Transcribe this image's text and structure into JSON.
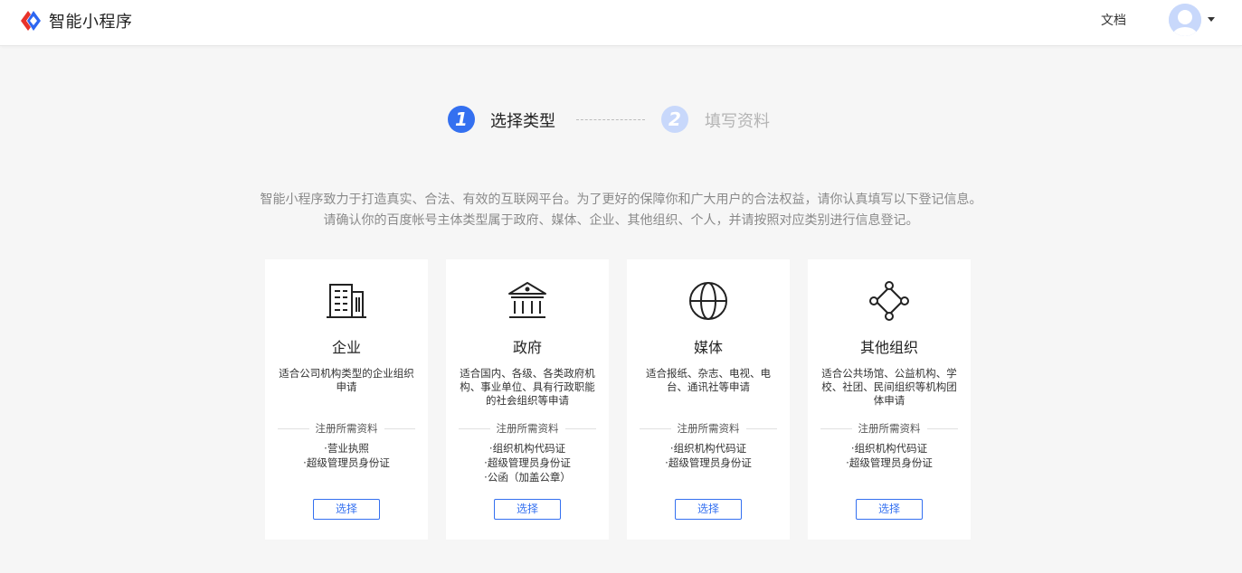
{
  "header": {
    "app_name": "智能小程序",
    "docs_label": "文档"
  },
  "steps": [
    {
      "number": "1",
      "label": "选择类型",
      "state": "active"
    },
    {
      "number": "2",
      "label": "填写资料",
      "state": "inactive"
    }
  ],
  "intro": {
    "line1": "智能小程序致力于打造真实、合法、有效的互联网平台。为了更好的保障你和广大用户的合法权益，请你认真填写以下登记信息。",
    "line2": "请确认你的百度帐号主体类型属于政府、媒体、企业、其他组织、个人，并请按照对应类别进行信息登记。"
  },
  "cards": [
    {
      "icon": "building-icon",
      "title": "企业",
      "desc": "适合公司机构类型的企业组织申请",
      "req_title": "注册所需资料",
      "requirements": [
        "·营业执照",
        "·超级管理员身份证"
      ],
      "button": "选择"
    },
    {
      "icon": "government-icon",
      "title": "政府",
      "desc": "适合国内、各级、各类政府机构、事业单位、具有行政职能的社会组织等申请",
      "req_title": "注册所需资料",
      "requirements": [
        "·组织机构代码证",
        "·超级管理员身份证",
        "·公函（加盖公章）"
      ],
      "button": "选择"
    },
    {
      "icon": "globe-icon",
      "title": "媒体",
      "desc": "适合报纸、杂志、电视、电台、通讯社等申请",
      "req_title": "注册所需资料",
      "requirements": [
        "·组织机构代码证",
        "·超级管理员身份证"
      ],
      "button": "选择"
    },
    {
      "icon": "network-icon",
      "title": "其他组织",
      "desc": "适合公共场馆、公益机构、学校、社团、民间组织等机构团体申请",
      "req_title": "注册所需资料",
      "requirements": [
        "·组织机构代码证",
        "·超级管理员身份证"
      ],
      "button": "选择"
    }
  ],
  "colors": {
    "accent": "#3470f0",
    "accent_light": "#c8d8fb",
    "logo_red": "#e8332b",
    "logo_blue": "#2d66f1"
  }
}
